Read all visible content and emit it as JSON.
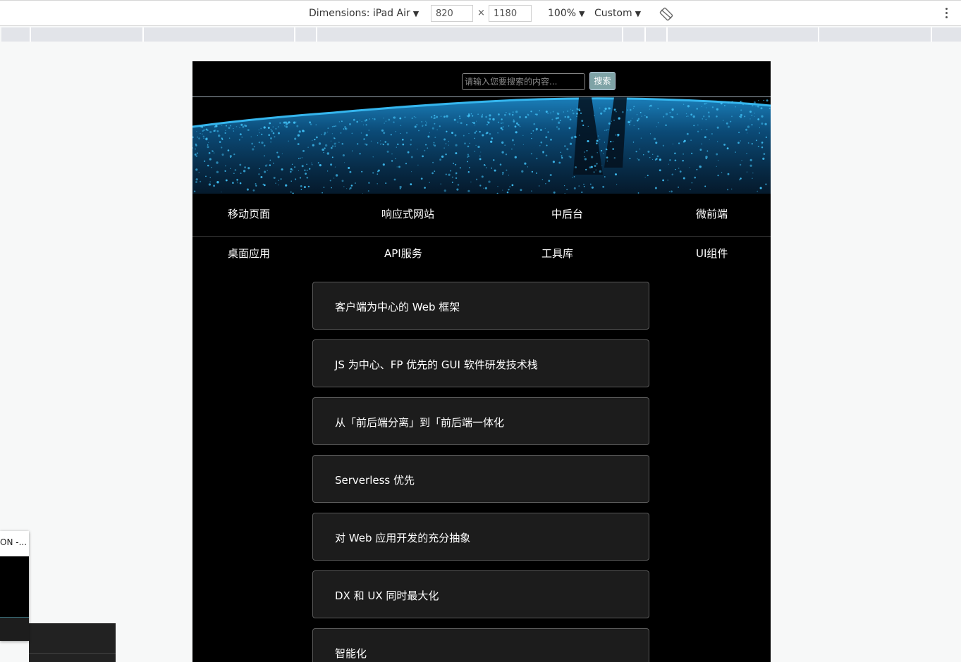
{
  "toolbar": {
    "dimensions_label": "Dimensions: iPad Air",
    "width_value": "820",
    "times_symbol": "×",
    "height_value": "1180",
    "zoom_label": "100%",
    "throttle_label": "Custom",
    "caret": "▼"
  },
  "page": {
    "search": {
      "placeholder": "请输入您要搜索的内容...",
      "button_label": "搜索"
    },
    "nav_row1": [
      "移动页面",
      "响应式网站",
      "中后台",
      "微前端"
    ],
    "nav_row2": [
      "桌面应用",
      "API服务",
      "工具库",
      "UI组件"
    ],
    "cards": [
      "客户端为中心的 Web 框架",
      "JS 为中心、FP 优先的 GUI 软件研发技术栈",
      "从「前后端分离」到「前后端一体化",
      "Serverless 优先",
      "对 Web 应用开发的充分抽象",
      "DX 和 UX 同时最大化",
      "智能化"
    ]
  },
  "overlay": {
    "title_fragment": "ON -..."
  },
  "colors": {
    "page_background": "#000000",
    "card_background": "#1c1c1c",
    "search_button": "#7ea3a6",
    "banner_accent": "#1da6e0"
  }
}
